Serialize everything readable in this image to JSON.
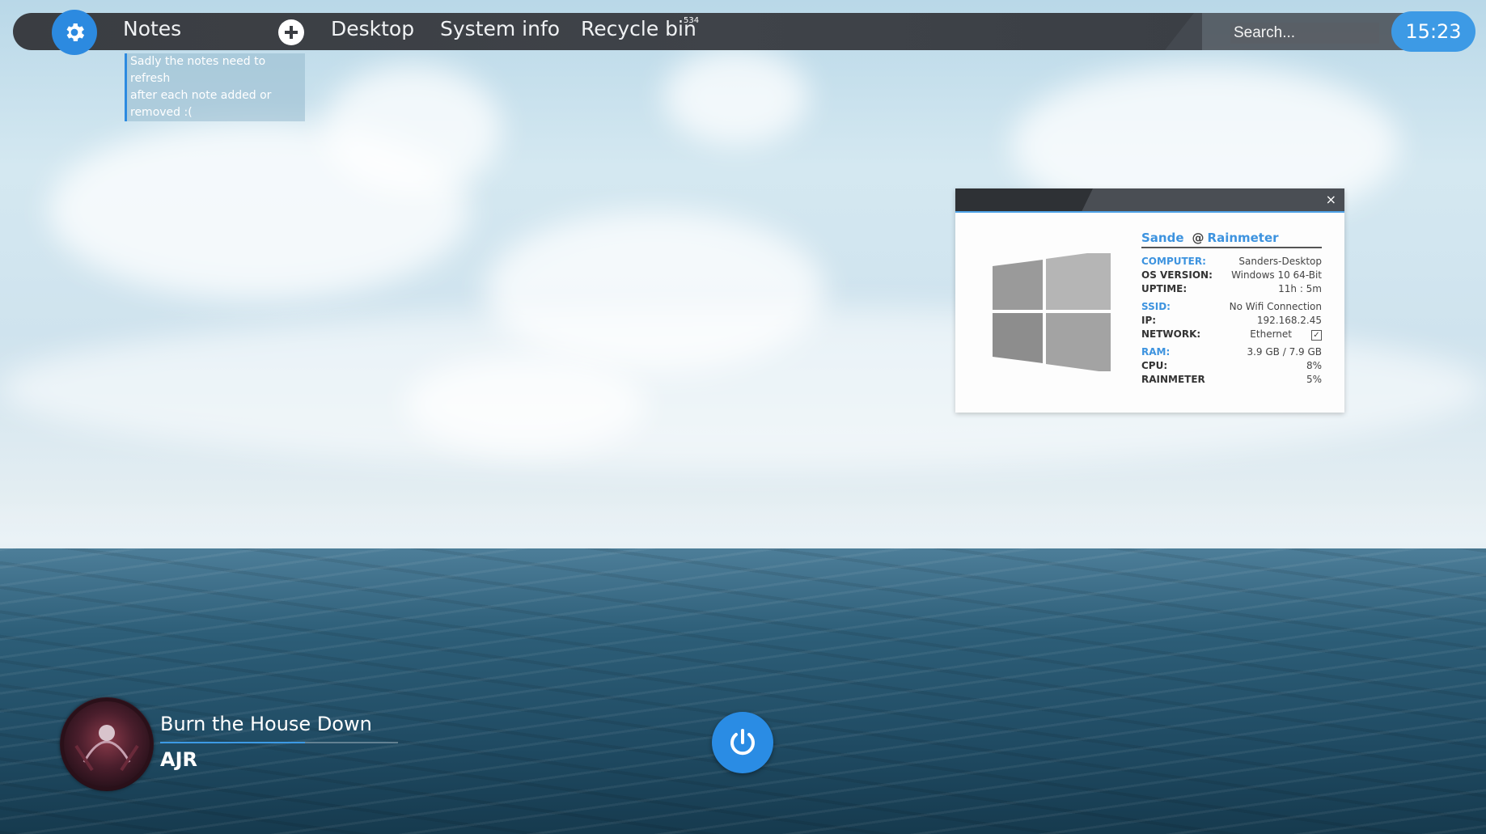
{
  "topbar": {
    "notes_label": "Notes",
    "desktop_label": "Desktop",
    "system_info_label": "System info",
    "recycle_bin_label": "Recycle bin",
    "recycle_bin_count": "534",
    "search_placeholder": "Search...",
    "clock": "15:23"
  },
  "note": {
    "lines": [
      "Sadly the notes need to refresh",
      "after each note added or",
      "removed :("
    ]
  },
  "sysinfo": {
    "user": "Sande",
    "at": "@",
    "app": "Rainmeter",
    "close_glyph": "×",
    "rows": [
      {
        "key": "COMPUTER:",
        "value": "Sanders-Desktop"
      },
      {
        "key": "OS VERSION:",
        "value": "Windows 10  64-Bit"
      },
      {
        "key": "UPTIME:",
        "value": "11h : 5m"
      },
      {
        "key": "SSID:",
        "value": "No Wifi Connection"
      },
      {
        "key": "IP:",
        "value": "192.168.2.45"
      },
      {
        "key": "NETWORK:",
        "value": "Ethernet"
      },
      {
        "key": "RAM:",
        "value": "3.9 GB / 7.9 GB"
      },
      {
        "key": "CPU:",
        "value": "8%"
      },
      {
        "key": "RAINMETER",
        "value": "5%"
      }
    ],
    "network_check": "✓"
  },
  "player": {
    "title": "Burn the House Down",
    "artist": "AJR",
    "progress": 0.61
  },
  "colors": {
    "accent": "#2c8ae0",
    "bar": "#3a3d42"
  }
}
